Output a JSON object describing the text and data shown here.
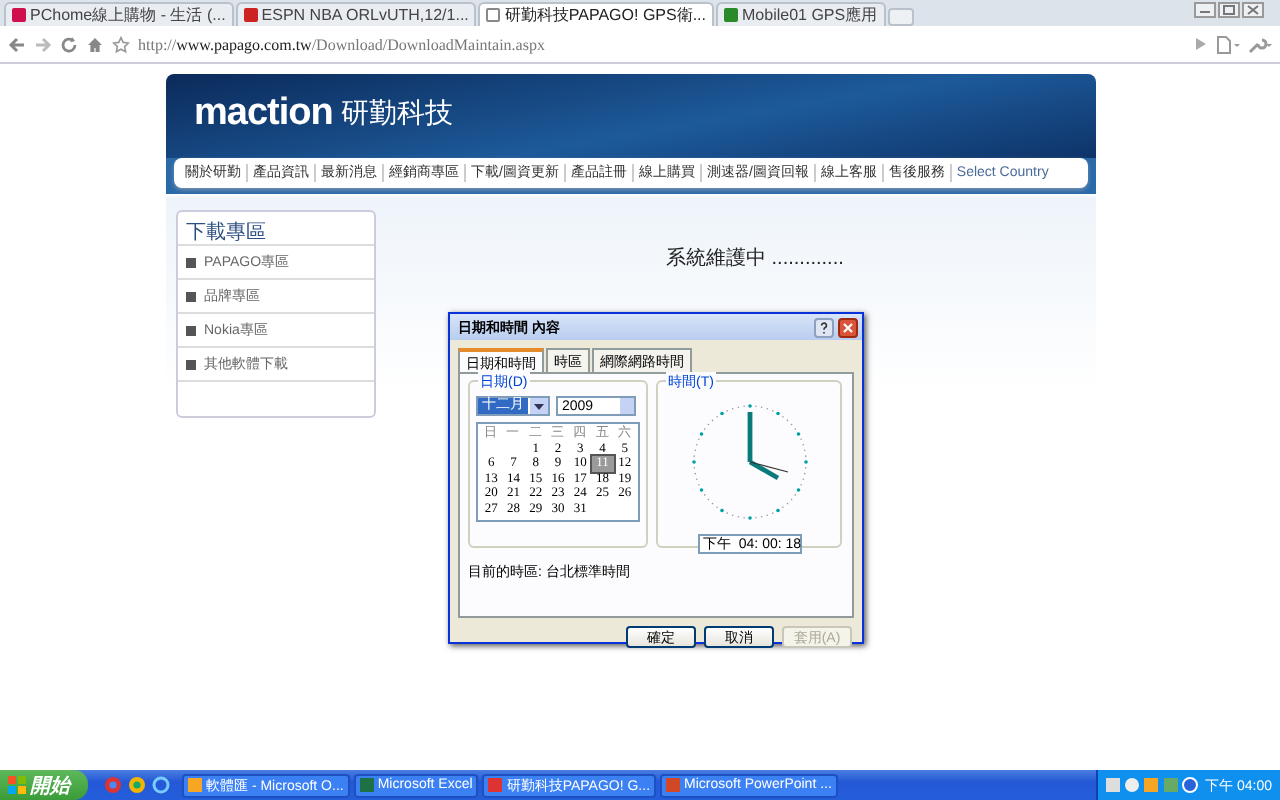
{
  "browser": {
    "tabs": [
      {
        "label": "PChome線上購物 - 生活 (...",
        "selected": false
      },
      {
        "label": "ESPN NBA ORLvUTH,12/1...",
        "selected": false
      },
      {
        "label": "研勤科技PAPAGO! GPS衛...",
        "selected": true
      },
      {
        "label": "Mobile01 GPS應用",
        "selected": false
      }
    ],
    "url": {
      "scheme": "http://",
      "host": "www.papago.com.tw",
      "path": "/Download/DownloadMaintain.aspx"
    }
  },
  "site": {
    "logo": "maction",
    "logo_cjk": "研勤科技",
    "nav": [
      "關於研勤",
      "產品資訊",
      "最新消息",
      "經銷商專區",
      "下載/圖資更新",
      "產品註冊",
      "線上購買",
      "測速器/圖資回報",
      "線上客服",
      "售後服務",
      "Select Country"
    ],
    "sidebar": {
      "title": "下載專區",
      "items": [
        "PAPAGO專區",
        "品牌專區",
        "Nokia專區",
        "其他軟體下載"
      ]
    },
    "message": "系統維護中 ............."
  },
  "dialog": {
    "title": "日期和時間 內容",
    "tabs": [
      {
        "label": "日期和時間",
        "selected": true
      },
      {
        "label": "時區",
        "selected": false
      },
      {
        "label": "網際網路時間",
        "selected": false
      }
    ],
    "date_group": "日期(D)",
    "month": "十二月",
    "year": "2009",
    "weekdays": [
      "日",
      "一",
      "二",
      "三",
      "四",
      "五",
      "六"
    ],
    "days": [
      {
        "kind": "blank"
      },
      {
        "kind": "blank"
      },
      {
        "label": "1",
        "selected": false
      },
      {
        "label": "2",
        "selected": false
      },
      {
        "label": "3",
        "selected": false
      },
      {
        "label": "4",
        "selected": false
      },
      {
        "label": "5",
        "selected": false
      },
      {
        "label": "6",
        "selected": false
      },
      {
        "label": "7",
        "selected": false
      },
      {
        "label": "8",
        "selected": false
      },
      {
        "label": "9",
        "selected": false
      },
      {
        "label": "10",
        "selected": false
      },
      {
        "label": "11",
        "selected": true
      },
      {
        "label": "12",
        "selected": false
      },
      {
        "label": "13",
        "selected": false
      },
      {
        "label": "14",
        "selected": false
      },
      {
        "label": "15",
        "selected": false
      },
      {
        "label": "16",
        "selected": false
      },
      {
        "label": "17",
        "selected": false
      },
      {
        "label": "18",
        "selected": false
      },
      {
        "label": "19",
        "selected": false
      },
      {
        "label": "20",
        "selected": false
      },
      {
        "label": "21",
        "selected": false
      },
      {
        "label": "22",
        "selected": false
      },
      {
        "label": "23",
        "selected": false
      },
      {
        "label": "24",
        "selected": false
      },
      {
        "label": "25",
        "selected": false
      },
      {
        "label": "26",
        "selected": false
      },
      {
        "label": "27",
        "selected": false
      },
      {
        "label": "28",
        "selected": false
      },
      {
        "label": "29",
        "selected": false
      },
      {
        "label": "30",
        "selected": false
      },
      {
        "label": "31",
        "selected": false
      }
    ],
    "time_group": "時間(T)",
    "time": "下午  04: 00: 18",
    "timezone": "目前的時區: 台北標準時間",
    "buttons": [
      {
        "label": "確定",
        "disabled": false
      },
      {
        "label": "取消",
        "disabled": false
      },
      {
        "label": "套用(A)",
        "disabled": true
      }
    ]
  },
  "taskbar": {
    "start": "開始",
    "tasks": [
      "軟體匯 - Microsoft O...",
      "Microsoft Excel",
      "研勤科技PAPAGO! G...",
      "Microsoft PowerPoint ..."
    ],
    "clock": "下午 04:00"
  }
}
